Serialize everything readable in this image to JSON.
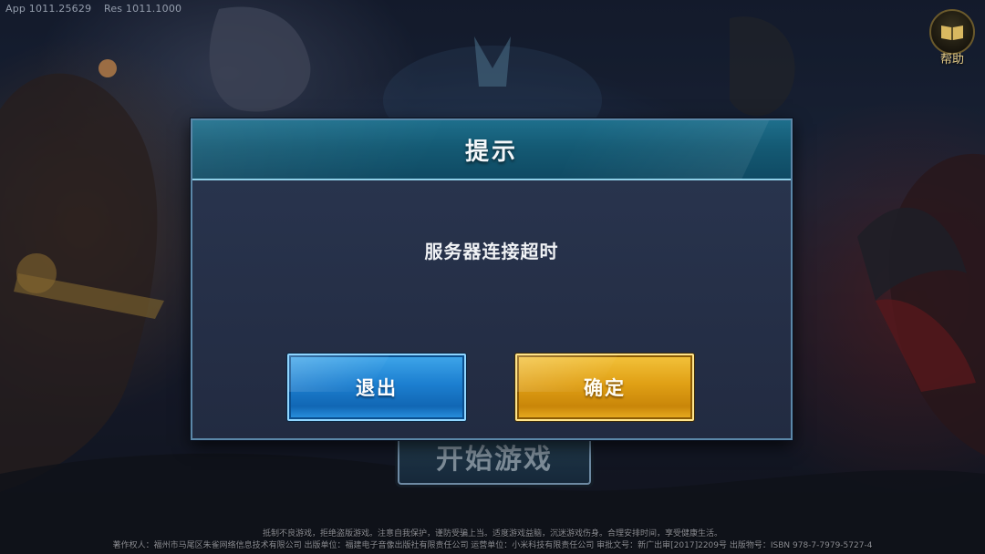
{
  "status": {
    "app_version": "App 1011.25629",
    "res_version": "Res 1011.1000"
  },
  "help_button": {
    "label": "帮助",
    "icon": "book-icon"
  },
  "main": {
    "start_button_label": "开始游戏"
  },
  "dialog": {
    "title": "提示",
    "message": "服务器连接超时",
    "exit_button": "退出",
    "confirm_button": "确定"
  },
  "footer": {
    "line1": "抵制不良游戏，拒绝盗版游戏。注意自我保护，谨防受骗上当。适度游戏益脑，沉迷游戏伤身。合理安排时间，享受健康生活。",
    "line2": "著作权人：福州市马尾区朱雀网络信息技术有限公司 出版单位：福建电子音像出版社有限责任公司 运营单位：小米科技有限责任公司 审批文号：新广出审[2017]2209号 出版物号：ISBN 978-7-7979-5727-4"
  },
  "colors": {
    "dialog_header": "#145a74",
    "dialog_body": "#252f47",
    "exit_button": "#1c7fd0",
    "confirm_button": "#e0a015",
    "help_label": "#e8cf8a"
  }
}
